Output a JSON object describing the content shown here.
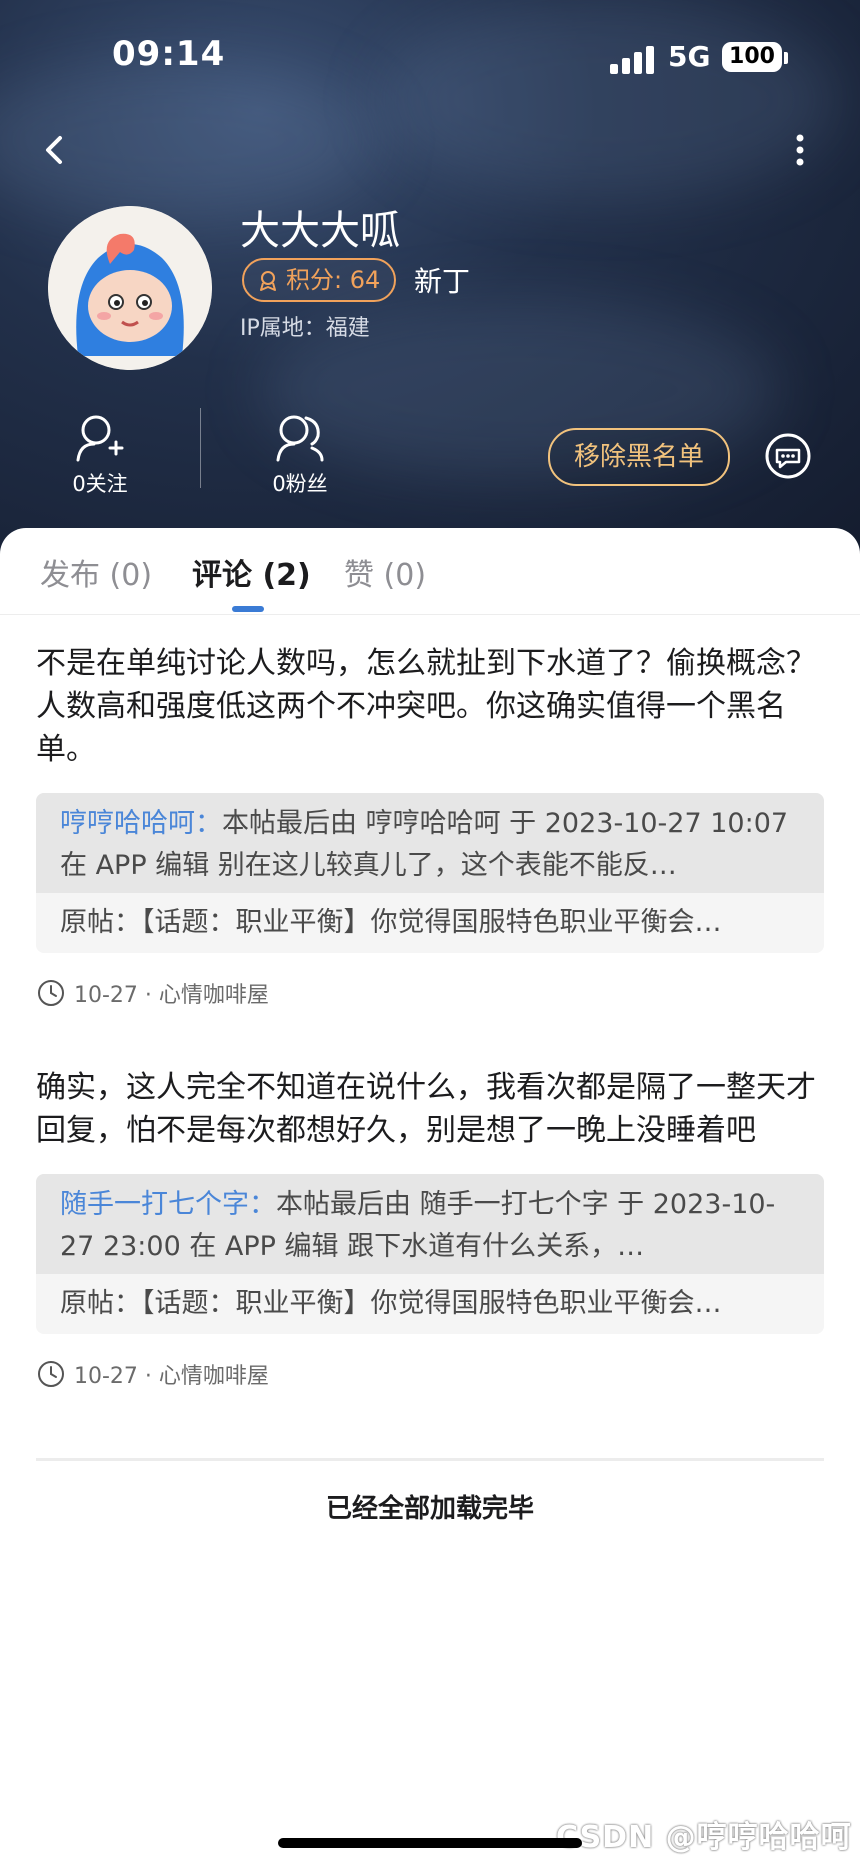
{
  "status_bar": {
    "time": "09:14",
    "network": "5G",
    "battery": "100"
  },
  "profile": {
    "name": "大大大呱",
    "points_label": "积分: 64",
    "level": "新丁",
    "ip_location": "IP属地：福建",
    "following_label": "0关注",
    "followers_label": "0粉丝",
    "unblock_label": "移除黑名单"
  },
  "tabs": [
    {
      "label": "发布 (0)",
      "active": false
    },
    {
      "label": "评论 (2)",
      "active": true
    },
    {
      "label": "赞 (0)",
      "active": false
    }
  ],
  "comments": [
    {
      "text": "不是在单纯讨论人数吗，怎么就扯到下水道了？偷换概念？人数高和强度低这两个不冲突吧。你这确实值得一个黑名单。",
      "reply_author": "哼哼哈哈呵：",
      "reply_text": "本帖最后由 哼哼哈哈呵 于 2023-10-27 10:07 在 APP 编辑 别在这儿较真儿了，这个表能不能反…",
      "origin_text": "原帖：【话题：职业平衡】你觉得国服特色职业平衡会…",
      "meta": "10-27 · 心情咖啡屋"
    },
    {
      "text": "确实，这人完全不知道在说什么，我看次都是隔了一整天才回复，怕不是每次都想好久，别是想了一晚上没睡着吧",
      "reply_author": "随手一打七个字：",
      "reply_text": "本帖最后由 随手一打七个字 于 2023-10-27 23:00 在 APP 编辑 跟下水道有什么关系，…",
      "origin_text": "原帖：【话题：职业平衡】你觉得国服特色职业平衡会…",
      "meta": "10-27 · 心情咖啡屋"
    }
  ],
  "end_text": "已经全部加载完毕",
  "watermark": "CSDN @哼哼哈哈呵",
  "colors": {
    "accent_blue": "#4a86d8",
    "badge_orange": "#f1a25b",
    "unblock_gold": "#f1c27d"
  },
  "icons": [
    "back-icon",
    "more-icon",
    "points-icon",
    "add-user-icon",
    "users-icon",
    "message-icon",
    "clock-icon"
  ]
}
